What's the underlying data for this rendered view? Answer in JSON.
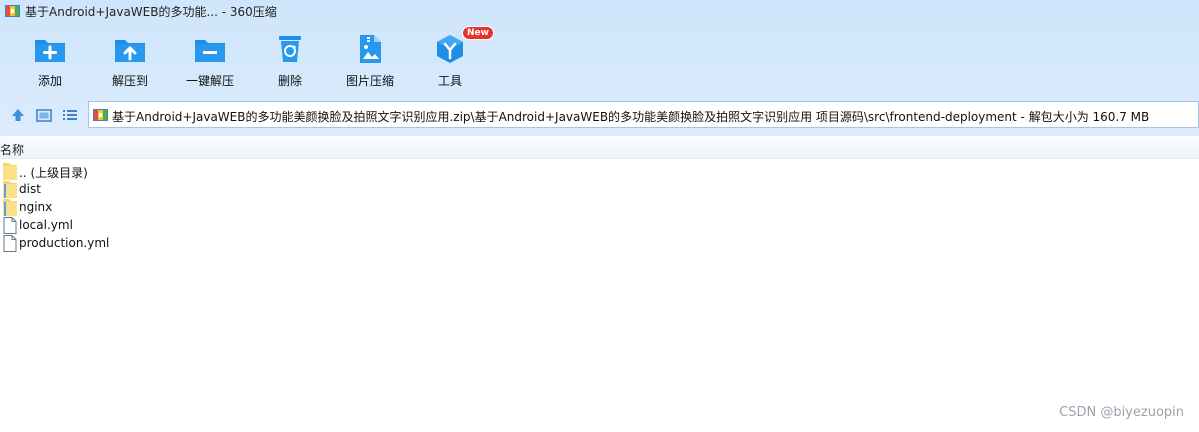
{
  "window": {
    "title": "基于Android+JavaWEB的多功能... - 360压缩",
    "app_icon": "archive-icon"
  },
  "toolbar": {
    "buttons": [
      {
        "label": "添加",
        "icon": "add-folder-icon"
      },
      {
        "label": "解压到",
        "icon": "extract-to-folder-icon"
      },
      {
        "label": "一键解压",
        "icon": "quick-extract-icon"
      },
      {
        "label": "删除",
        "icon": "recycle-bin-icon"
      },
      {
        "label": "图片压缩",
        "icon": "image-compress-icon"
      },
      {
        "label": "工具",
        "icon": "tools-cube-icon",
        "badge": "New"
      }
    ]
  },
  "nav": {
    "path": "基于Android+JavaWEB的多功能美颜换脸及拍照文字识别应用.zip\\基于Android+JavaWEB的多功能美颜换脸及拍照文字识别应用 项目源码\\src\\frontend-deployment - 解包大小为 160.7 MB"
  },
  "file_list": {
    "column_name": "名称",
    "items": [
      {
        "name": ".. (上级目录)",
        "type": "folder"
      },
      {
        "name": "dist",
        "type": "folder"
      },
      {
        "name": "nginx",
        "type": "folder"
      },
      {
        "name": "local.yml",
        "type": "file"
      },
      {
        "name": "production.yml",
        "type": "file"
      }
    ]
  },
  "watermark": "CSDN @biyezuopin",
  "colors": {
    "toolbar_bg": "#d6e9fc",
    "icon_blue": "#1e8ee6",
    "folder_yellow": "#f7d56a",
    "badge_red": "#e8332a"
  }
}
